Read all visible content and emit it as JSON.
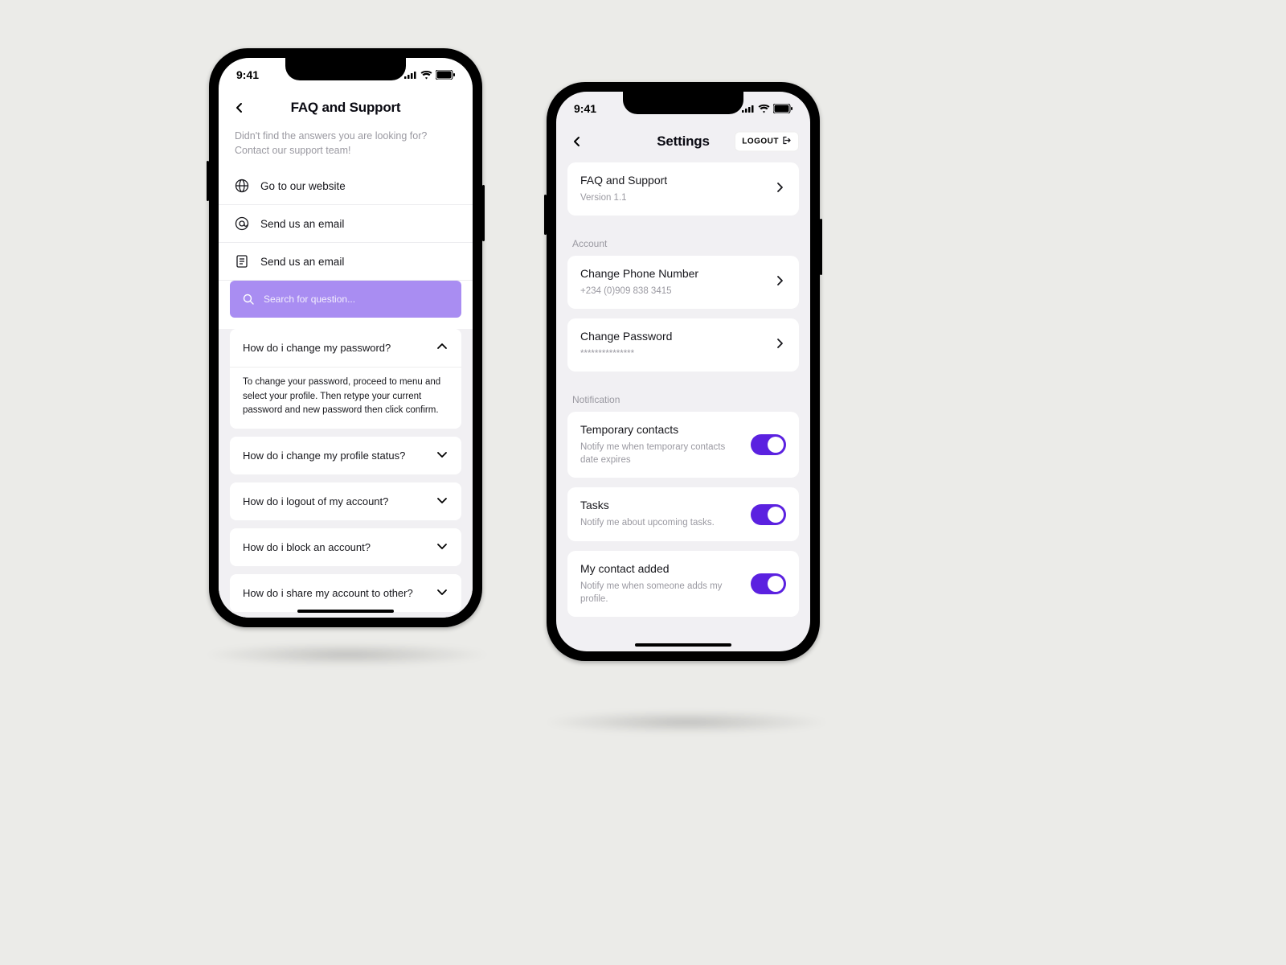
{
  "status": {
    "time": "9:41"
  },
  "faq": {
    "title": "FAQ and Support",
    "subtext": "Didn't find the answers you are looking for? Contact our support team!",
    "links": [
      {
        "label": "Go to our website"
      },
      {
        "label": "Send us an email"
      },
      {
        "label": "Send us an email"
      }
    ],
    "search_placeholder": "Search for question...",
    "q_open": {
      "q": "How do i change my password?",
      "a": "To change your password, proceed to menu and select your profile. Then retype your current password and new password then click confirm."
    },
    "questions": [
      "How do i change my profile status?",
      "How do i logout of my account?",
      "How do i block an account?",
      "How do i share my account to other?"
    ]
  },
  "settings": {
    "title": "Settings",
    "logout_label": "LOGOUT",
    "faq_card": {
      "title": "FAQ and Support",
      "sub": "Version 1.1"
    },
    "section_account": "Account",
    "phone_card": {
      "title": "Change Phone Number",
      "sub": "+234 (0)909 838 3415"
    },
    "password_card": {
      "title": "Change Password",
      "sub": "***************"
    },
    "section_notification": "Notification",
    "toggles": [
      {
        "title": "Temporary contacts",
        "sub": "Notify me when temporary contacts date expires"
      },
      {
        "title": "Tasks",
        "sub": "Notify me about upcoming tasks."
      },
      {
        "title": "My contact added",
        "sub": "Notify me when someone adds my profile."
      }
    ]
  }
}
